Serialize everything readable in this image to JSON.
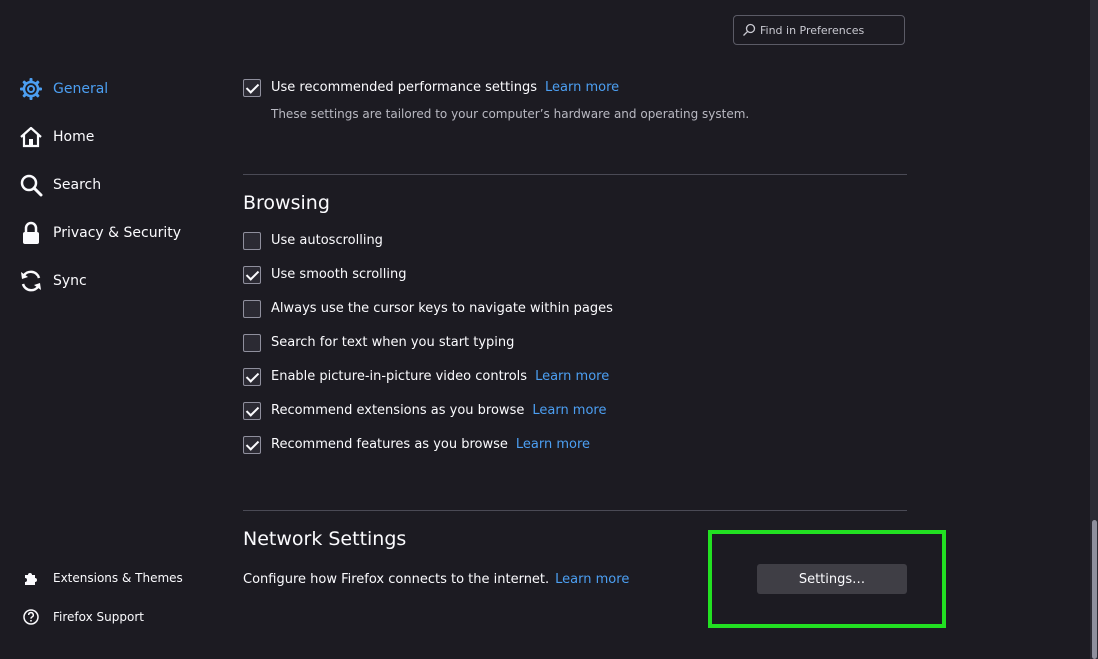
{
  "search": {
    "placeholder": "Find in Preferences"
  },
  "sidebar": {
    "items": [
      {
        "label": "General",
        "icon": "gear-icon",
        "active": true
      },
      {
        "label": "Home",
        "icon": "home-icon"
      },
      {
        "label": "Search",
        "icon": "search-icon"
      },
      {
        "label": "Privacy & Security",
        "icon": "lock-icon"
      },
      {
        "label": "Sync",
        "icon": "sync-icon"
      }
    ],
    "footer": [
      {
        "label": "Extensions & Themes",
        "icon": "puzzle-icon"
      },
      {
        "label": "Firefox Support",
        "icon": "help-icon"
      }
    ]
  },
  "performance": {
    "recommended_label": "Use recommended performance settings",
    "recommended_checked": true,
    "learn_more": "Learn more",
    "description": "These settings are tailored to your computer’s hardware and operating system."
  },
  "browsing": {
    "heading": "Browsing",
    "options": [
      {
        "label": "Use autoscrolling",
        "checked": false,
        "learn_more": ""
      },
      {
        "label": "Use smooth scrolling",
        "checked": true,
        "learn_more": ""
      },
      {
        "label": "Always use the cursor keys to navigate within pages",
        "checked": false,
        "learn_more": ""
      },
      {
        "label": "Search for text when you start typing",
        "checked": false,
        "learn_more": ""
      },
      {
        "label": "Enable picture-in-picture video controls",
        "checked": true,
        "learn_more": "Learn more"
      },
      {
        "label": "Recommend extensions as you browse",
        "checked": true,
        "learn_more": "Learn more"
      },
      {
        "label": "Recommend features as you browse",
        "checked": true,
        "learn_more": "Learn more"
      }
    ]
  },
  "network": {
    "heading": "Network Settings",
    "description": "Configure how Firefox connects to the internet.",
    "learn_more": "Learn more",
    "button": "Settings…"
  },
  "colors": {
    "accent": "#4c9ff2",
    "highlight": "#22e022",
    "background": "#1c1b22"
  }
}
